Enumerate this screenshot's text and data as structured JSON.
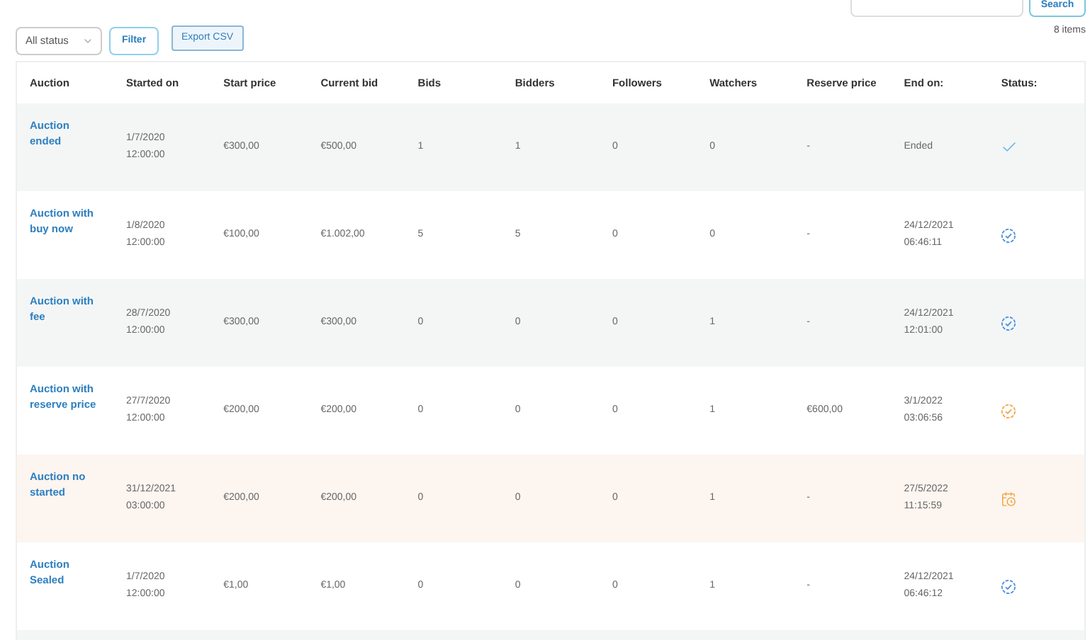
{
  "toolbar": {
    "status_select": "All status",
    "filter_button": "Filter",
    "export_button": "Export CSV",
    "search_button": "Search",
    "item_count": "8 items"
  },
  "table": {
    "columns": [
      "Auction",
      "Started on",
      "Start price",
      "Current bid",
      "Bids",
      "Bidders",
      "Followers",
      "Watchers",
      "Reserve price",
      "End on:",
      "Status:"
    ],
    "rows": [
      {
        "auction": "Auction ended",
        "started_on": [
          "1/7/2020",
          "12:00:00"
        ],
        "start_price": "€300,00",
        "current_bid": "€500,00",
        "bids": "1",
        "bidders": "1",
        "followers": "0",
        "watchers": "0",
        "reserve_price": "-",
        "end_on": [
          "Ended"
        ],
        "kind": "ended",
        "color": "#f4f6f6"
      },
      {
        "auction": "Auction with buy now",
        "started_on": [
          "1/8/2020",
          "12:00:00"
        ],
        "start_price": "€100,00",
        "current_bid": "€1.002,00",
        "bids": "5",
        "bidders": "5",
        "followers": "0",
        "watchers": "0",
        "reserve_price": "-",
        "end_on": [
          "24/12/2021",
          "06:46:11"
        ],
        "kind": "running",
        "color": "#ffffff"
      },
      {
        "auction": "Auction with fee",
        "started_on": [
          "28/7/2020",
          "12:00:00"
        ],
        "start_price": "€300,00",
        "current_bid": "€300,00",
        "bids": "0",
        "bidders": "0",
        "followers": "0",
        "watchers": "1",
        "reserve_price": "-",
        "end_on": [
          "24/12/2021",
          "12:01:00"
        ],
        "kind": "running",
        "color": "#f4f6f6"
      },
      {
        "auction": "Auction with reserve price",
        "started_on": [
          "27/7/2020",
          "12:00:00"
        ],
        "start_price": "€200,00",
        "current_bid": "€200,00",
        "bids": "0",
        "bidders": "0",
        "followers": "0",
        "watchers": "1",
        "reserve_price": "€600,00",
        "end_on": [
          "3/1/2022",
          "03:06:56"
        ],
        "kind": "reserve",
        "color": "#ffffff"
      },
      {
        "auction": "Auction no started",
        "started_on": [
          "31/12/2021",
          "03:00:00"
        ],
        "start_price": "€200,00",
        "current_bid": "€200,00",
        "bids": "0",
        "bidders": "0",
        "followers": "0",
        "watchers": "1",
        "reserve_price": "-",
        "end_on": [
          "27/5/2022",
          "11:15:59"
        ],
        "kind": "scheduled",
        "color": "#fdf5f0"
      },
      {
        "auction": "Auction Sealed",
        "started_on": [
          "1/7/2020",
          "12:00:00"
        ],
        "start_price": "€1,00",
        "current_bid": "€1,00",
        "bids": "0",
        "bidders": "0",
        "followers": "0",
        "watchers": "1",
        "reserve_price": "-",
        "end_on": [
          "24/12/2021",
          "06:46:12"
        ],
        "kind": "running",
        "color": "#ffffff"
      }
    ]
  }
}
